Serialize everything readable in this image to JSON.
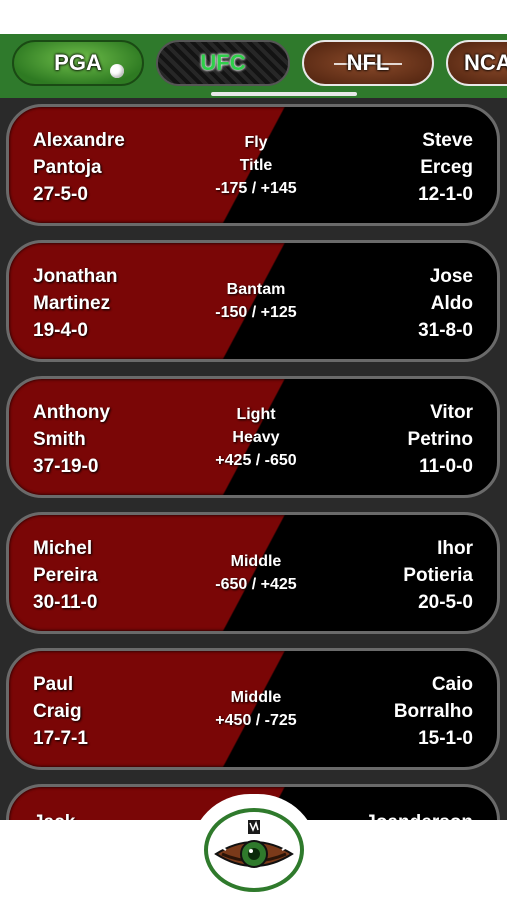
{
  "tabs": [
    {
      "label": "PGA"
    },
    {
      "label": "UFC"
    },
    {
      "label": "NFL"
    },
    {
      "label": "NCA"
    }
  ],
  "fights": [
    {
      "left_first": "Alexandre",
      "left_last": "Pantoja",
      "left_record": "27-5-0",
      "class_lines": [
        "Fly",
        "Title"
      ],
      "odds": "-175 / +145",
      "right_first": "Steve",
      "right_last": "Erceg",
      "right_record": "12-1-0"
    },
    {
      "left_first": "Jonathan",
      "left_last": "Martinez",
      "left_record": "19-4-0",
      "class_lines": [
        "Bantam"
      ],
      "odds": "-150 / +125",
      "right_first": "Jose",
      "right_last": "Aldo",
      "right_record": "31-8-0"
    },
    {
      "left_first": "Anthony",
      "left_last": "Smith",
      "left_record": "37-19-0",
      "class_lines": [
        "Light",
        "Heavy"
      ],
      "odds": "+425 / -650",
      "right_first": "Vitor",
      "right_last": "Petrino",
      "right_record": "11-0-0"
    },
    {
      "left_first": "Michel",
      "left_last": "Pereira",
      "left_record": "30-11-0",
      "class_lines": [
        "Middle"
      ],
      "odds": "-650 / +425",
      "right_first": "Ihor",
      "right_last": "Potieria",
      "right_record": "20-5-0"
    },
    {
      "left_first": "Paul",
      "left_last": "Craig",
      "left_record": "17-7-1",
      "class_lines": [
        "Middle"
      ],
      "odds": "+450 / -725",
      "right_first": "Caio",
      "right_last": "Borralho",
      "right_record": "15-1-0"
    },
    {
      "left_first": "Jack",
      "left_last": "",
      "left_record": "",
      "class_lines": [],
      "odds": "",
      "right_first": "Joanderson",
      "right_last": "",
      "right_record": ""
    }
  ],
  "colors": {
    "accent_green": "#2f7a2c",
    "card_red": "#7a0606",
    "card_black": "#000000"
  },
  "icons": {
    "center_button": "eye-icon"
  }
}
